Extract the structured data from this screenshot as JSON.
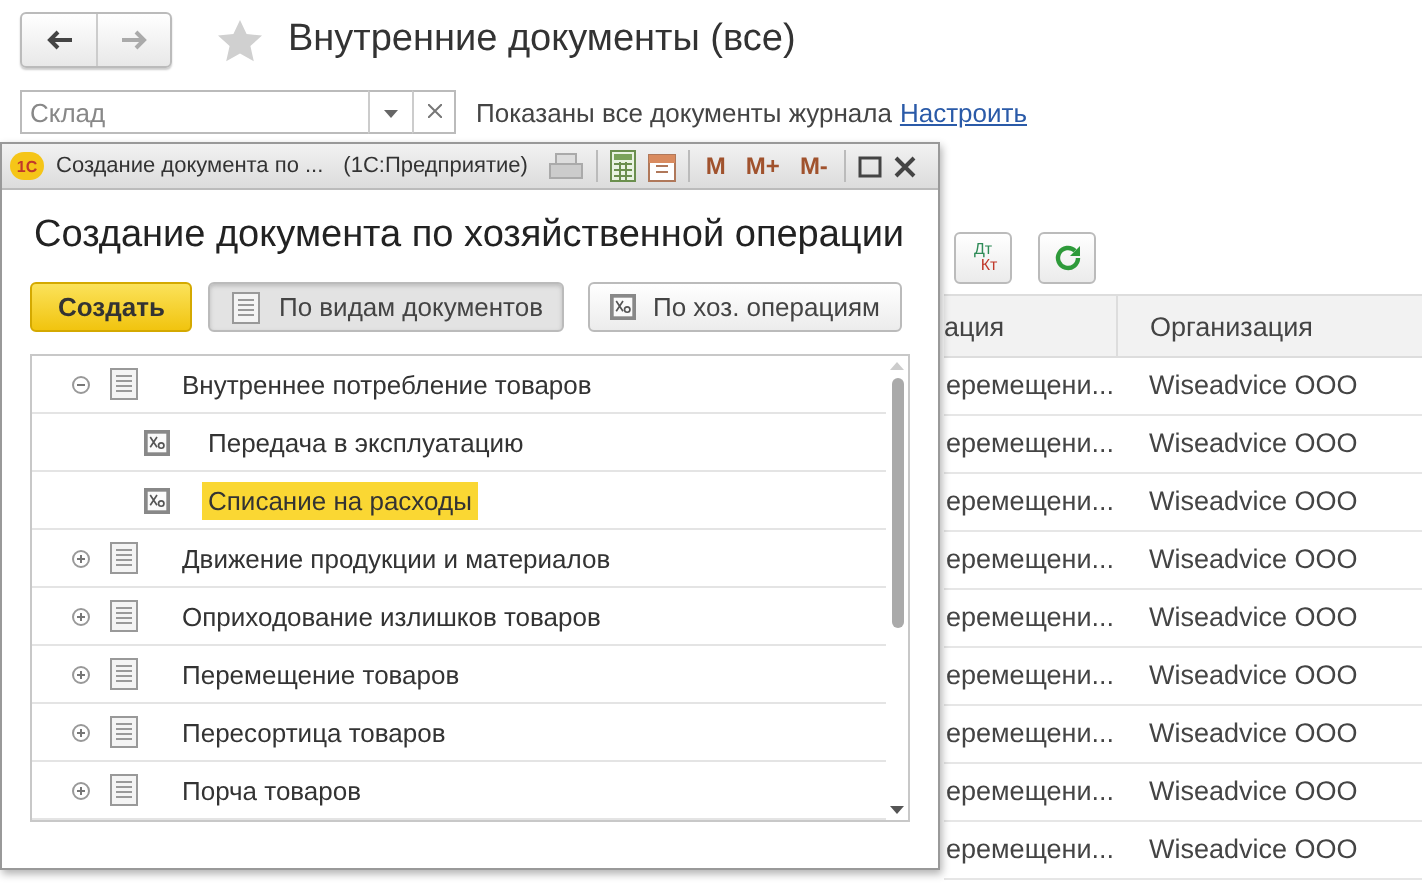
{
  "page": {
    "title": "Внутренние документы (все)",
    "filter": {
      "placeholder": "Склад"
    },
    "filter_note": "Показаны все документы журнала",
    "settings_link": "Настроить",
    "posting_button": {
      "top": "Дт",
      "bottom": "Кт"
    },
    "table": {
      "columns": [
        "ация",
        "Организация"
      ],
      "rows": [
        [
          "еремещени...",
          "Wiseadvice OOO"
        ],
        [
          "еремещени...",
          "Wiseadvice OOO"
        ],
        [
          "еремещени...",
          "Wiseadvice OOO"
        ],
        [
          "еремещени...",
          "Wiseadvice OOO"
        ],
        [
          "еремещени...",
          "Wiseadvice OOO"
        ],
        [
          "еремещени...",
          "Wiseadvice OOO"
        ],
        [
          "еремещени...",
          "Wiseadvice OOO"
        ],
        [
          "еремещени...",
          "Wiseadvice OOO"
        ],
        [
          "еремещени...",
          "Wiseadvice OOO"
        ]
      ]
    }
  },
  "dialog": {
    "app_logo": "1С",
    "window_title": "Создание документа по ...",
    "app_name": "(1С:Предприятие)",
    "memory_buttons": [
      "M",
      "M+",
      "M-"
    ],
    "heading": "Создание документа по хозяйственной операции",
    "create_button": "Создать",
    "view_tabs": [
      {
        "label": "По видам документов",
        "kind": "document",
        "selected": true
      },
      {
        "label": "По хоз. операциям",
        "kind": "operation",
        "selected": false
      }
    ],
    "tree": [
      {
        "label": "Внутреннее потребление товаров",
        "kind": "document",
        "expanded": true,
        "selected": false,
        "children": [
          {
            "label": "Передача в эксплуатацию",
            "kind": "operation",
            "selected": false
          },
          {
            "label": "Списание на расходы",
            "kind": "operation",
            "selected": true
          }
        ]
      },
      {
        "label": "Движение продукции и материалов",
        "kind": "document",
        "expanded": false,
        "selected": false
      },
      {
        "label": "Оприходование излишков товаров",
        "kind": "document",
        "expanded": false,
        "selected": false
      },
      {
        "label": "Перемещение товаров",
        "kind": "document",
        "expanded": false,
        "selected": false
      },
      {
        "label": "Пересортица товаров",
        "kind": "document",
        "expanded": false,
        "selected": false
      },
      {
        "label": "Порча товаров",
        "kind": "document",
        "expanded": false,
        "selected": false
      }
    ]
  }
}
